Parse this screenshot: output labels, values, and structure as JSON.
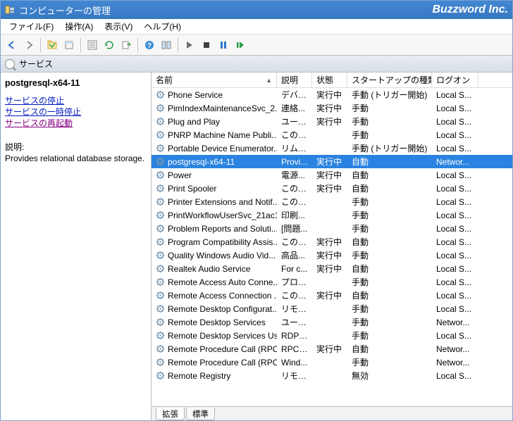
{
  "titlebar": {
    "title": "コンピューターの管理",
    "brand": "Buzzword Inc."
  },
  "menubar": {
    "file": "ファイル(F)",
    "action": "操作(A)",
    "view": "表示(V)",
    "help": "ヘルプ(H)"
  },
  "subhead": {
    "label": "サービス"
  },
  "leftpane": {
    "selected_service": "postgresql-x64-11",
    "link_stop": "サービスの停止",
    "link_pause": "サービスの一時停止",
    "link_restart": "サービスの再起動",
    "desc_label": "説明:",
    "desc_text": "Provides relational database storage."
  },
  "columns": {
    "name": "名前",
    "desc": "説明",
    "status": "状態",
    "startup": "スタートアップの種類",
    "logon": "ログオン"
  },
  "tabs": {
    "extended": "拡張",
    "standard": "標準"
  },
  "services": [
    {
      "name": "Phone Service",
      "desc": "デバイ...",
      "status": "実行中",
      "startup": "手動 (トリガー開始)",
      "logon": "Local S...",
      "selected": false
    },
    {
      "name": "PimIndexMaintenanceSvc_2...",
      "desc": "連絡...",
      "status": "実行中",
      "startup": "手動",
      "logon": "Local S...",
      "selected": false
    },
    {
      "name": "Plug and Play",
      "desc": "ユーザ...",
      "status": "実行中",
      "startup": "手動",
      "logon": "Local S...",
      "selected": false
    },
    {
      "name": "PNRP Machine Name Publi...",
      "desc": "このサ...",
      "status": "",
      "startup": "手動",
      "logon": "Local S...",
      "selected": false
    },
    {
      "name": "Portable Device Enumerator...",
      "desc": "リムー...",
      "status": "",
      "startup": "手動 (トリガー開始)",
      "logon": "Local S...",
      "selected": false
    },
    {
      "name": "postgresql-x64-11",
      "desc": "Provi...",
      "status": "実行中",
      "startup": "自動",
      "logon": "Networ...",
      "selected": true
    },
    {
      "name": "Power",
      "desc": "電源...",
      "status": "実行中",
      "startup": "自動",
      "logon": "Local S...",
      "selected": false
    },
    {
      "name": "Print Spooler",
      "desc": "このサ...",
      "status": "実行中",
      "startup": "自動",
      "logon": "Local S...",
      "selected": false
    },
    {
      "name": "Printer Extensions and Notif...",
      "desc": "このサ...",
      "status": "",
      "startup": "手動",
      "logon": "Local S...",
      "selected": false
    },
    {
      "name": "PrintWorkflowUserSvc_21ac1",
      "desc": "印刷...",
      "status": "",
      "startup": "手動",
      "logon": "Local S...",
      "selected": false
    },
    {
      "name": "Problem Reports and Soluti...",
      "desc": "[問題...",
      "status": "",
      "startup": "手動",
      "logon": "Local S...",
      "selected": false
    },
    {
      "name": "Program Compatibility Assis...",
      "desc": "このサ...",
      "status": "実行中",
      "startup": "自動",
      "logon": "Local S...",
      "selected": false
    },
    {
      "name": "Quality Windows Audio Vid...",
      "desc": "高品...",
      "status": "実行中",
      "startup": "手動",
      "logon": "Local S...",
      "selected": false
    },
    {
      "name": "Realtek Audio Service",
      "desc": "For c...",
      "status": "実行中",
      "startup": "自動",
      "logon": "Local S...",
      "selected": false
    },
    {
      "name": "Remote Access Auto Conne...",
      "desc": "プログ...",
      "status": "",
      "startup": "手動",
      "logon": "Local S...",
      "selected": false
    },
    {
      "name": "Remote Access Connection ...",
      "desc": "このコ...",
      "status": "実行中",
      "startup": "自動",
      "logon": "Local S...",
      "selected": false
    },
    {
      "name": "Remote Desktop Configurat...",
      "desc": "リモー...",
      "status": "",
      "startup": "手動",
      "logon": "Local S...",
      "selected": false
    },
    {
      "name": "Remote Desktop Services",
      "desc": "ユーザ...",
      "status": "",
      "startup": "手動",
      "logon": "Networ...",
      "selected": false
    },
    {
      "name": "Remote Desktop Services Us...",
      "desc": "RDP ...",
      "status": "",
      "startup": "手動",
      "logon": "Local S...",
      "selected": false
    },
    {
      "name": "Remote Procedure Call (RPC)",
      "desc": "RPCS...",
      "status": "実行中",
      "startup": "自動",
      "logon": "Networ...",
      "selected": false
    },
    {
      "name": "Remote Procedure Call (RPC...",
      "desc": "Wind...",
      "status": "",
      "startup": "手動",
      "logon": "Networ...",
      "selected": false
    },
    {
      "name": "Remote Registry",
      "desc": "リモー...",
      "status": "",
      "startup": "無効",
      "logon": "Local S...",
      "selected": false
    }
  ]
}
